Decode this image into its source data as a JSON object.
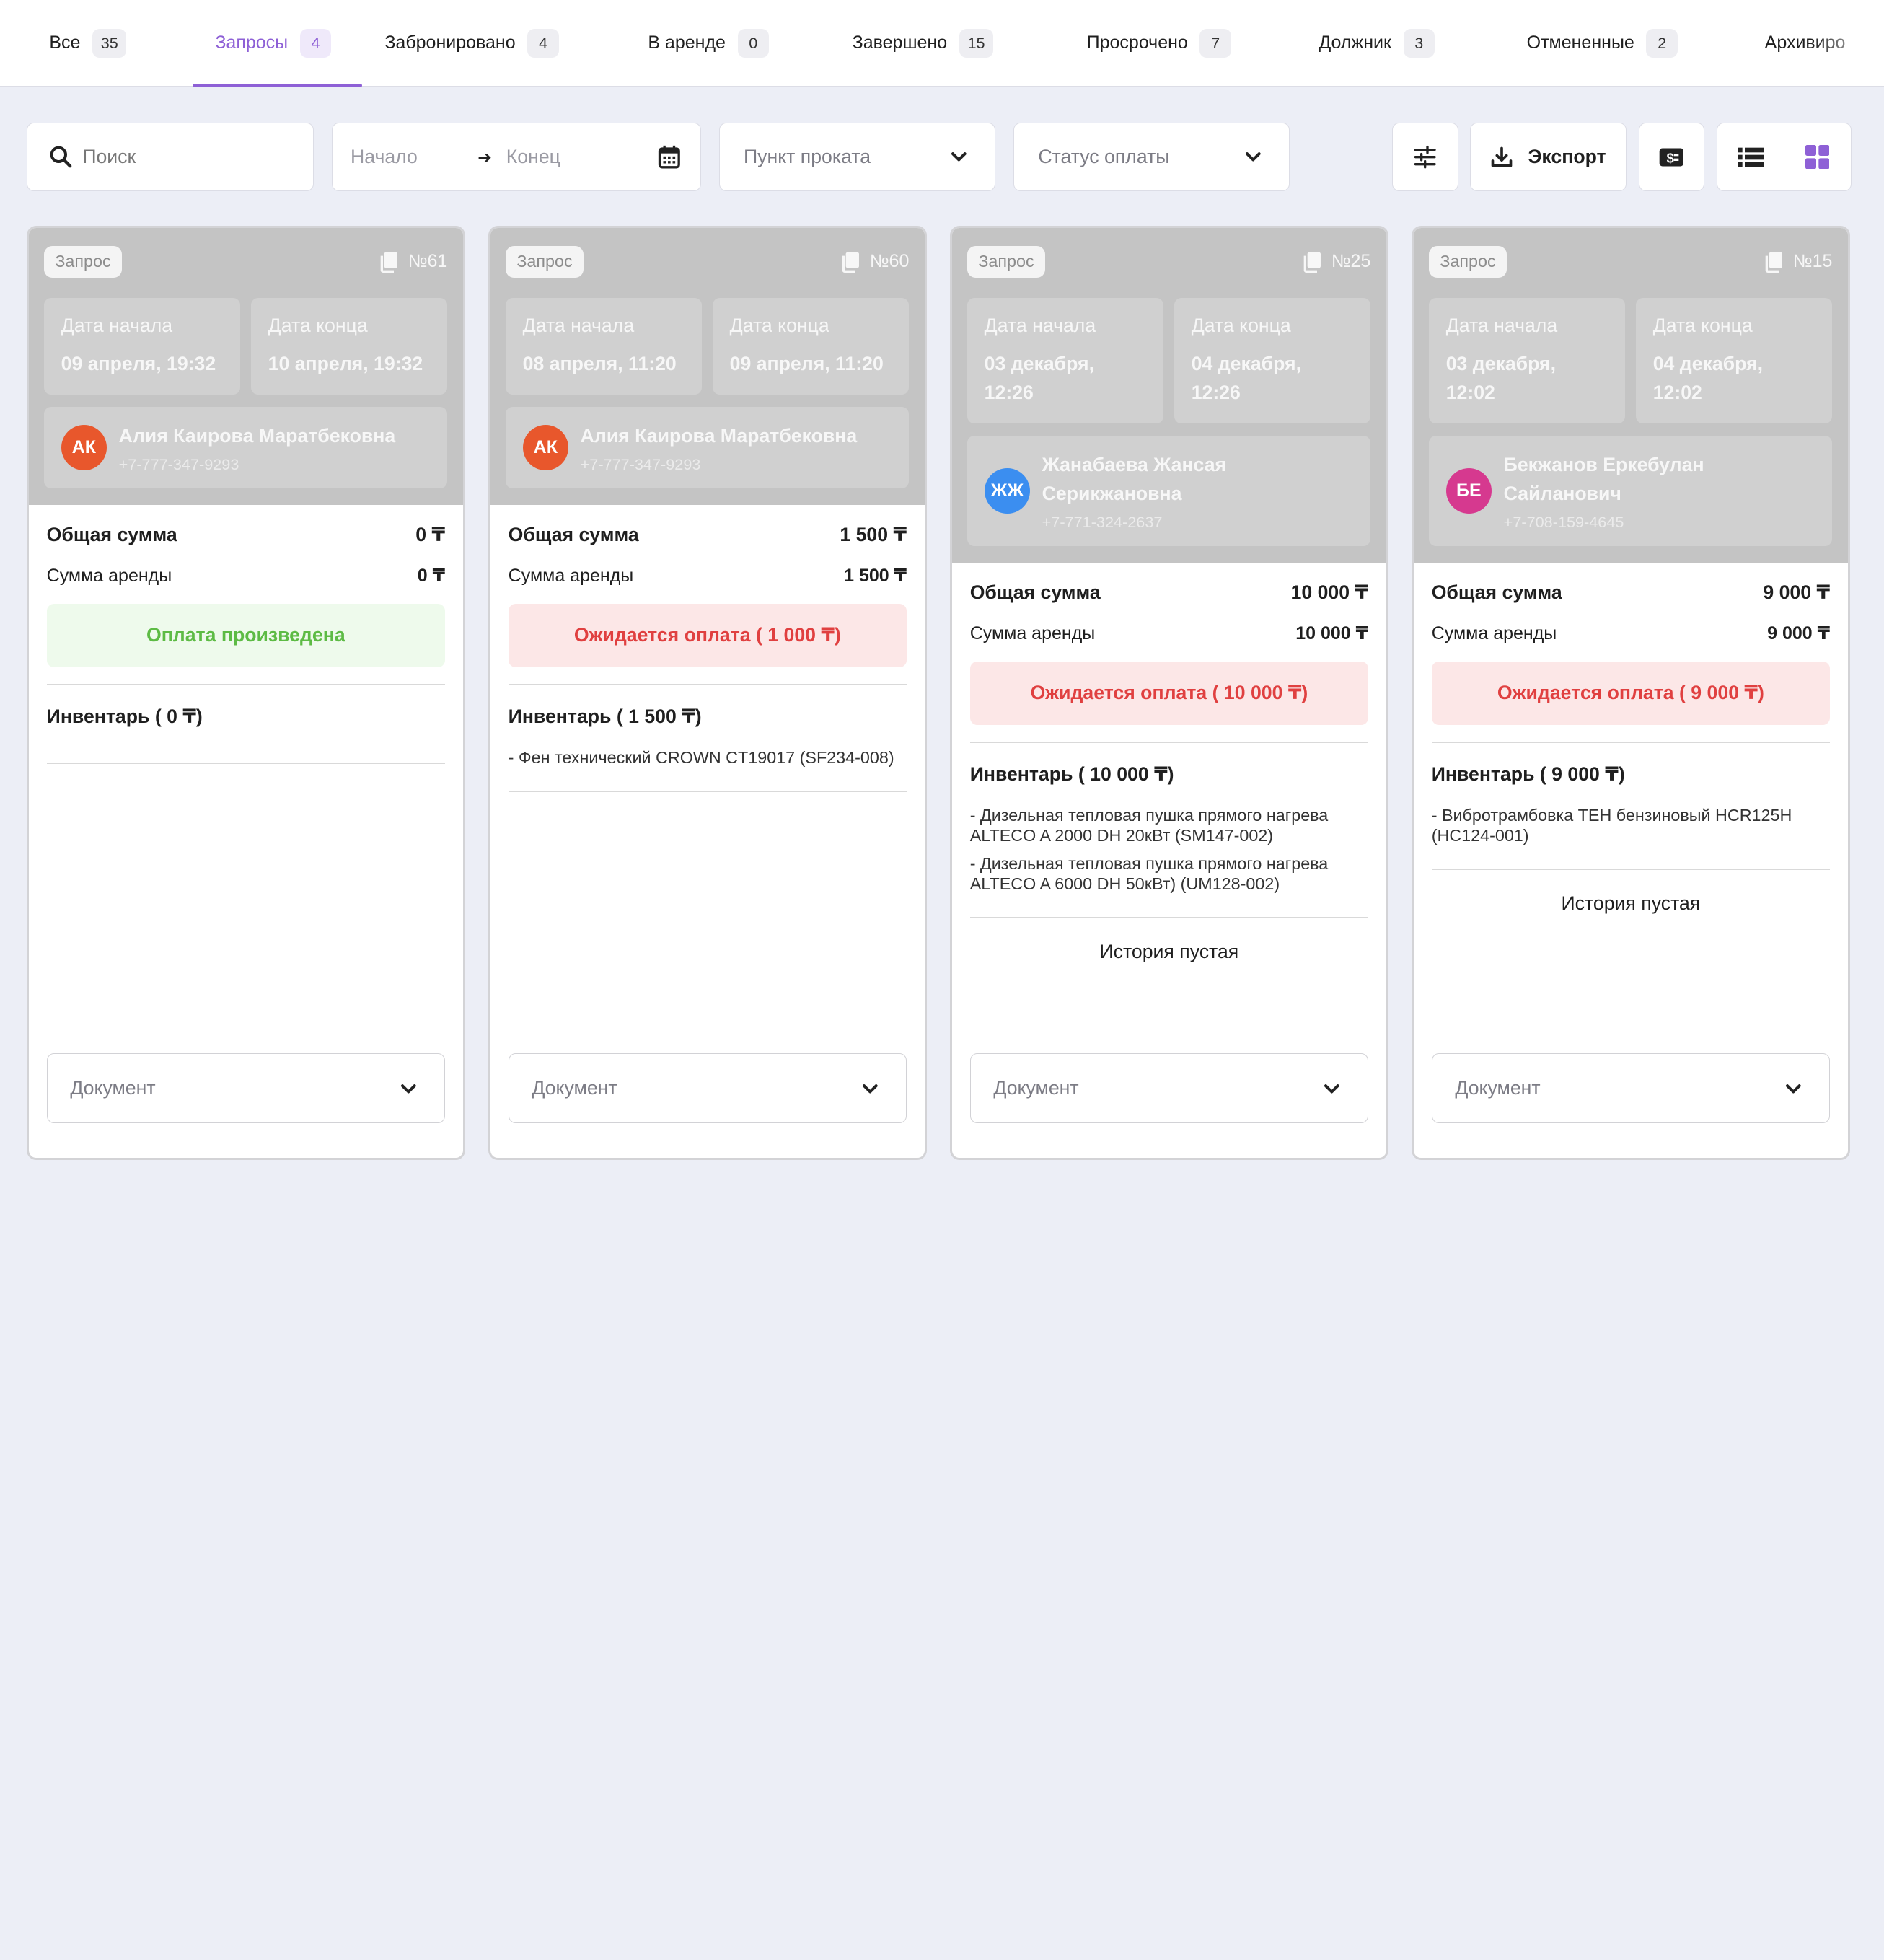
{
  "tabs": [
    {
      "label": "Все",
      "count": "35"
    },
    {
      "label": "Запросы",
      "count": "4"
    },
    {
      "label": "Забронировано",
      "count": "4"
    },
    {
      "label": "В аренде",
      "count": "0"
    },
    {
      "label": "Завершено",
      "count": "15"
    },
    {
      "label": "Просрочено",
      "count": "7"
    },
    {
      "label": "Должник",
      "count": "3"
    },
    {
      "label": "Отмененные",
      "count": "2"
    },
    {
      "label": "Архивиро",
      "count": ""
    }
  ],
  "active_tab": "Запросы",
  "colors": {
    "accent": "#8e60d6",
    "paid": "#5dbb45",
    "awaiting": "#e04040"
  },
  "toolbar": {
    "search_placeholder": "Поиск",
    "date_start_placeholder": "Начало",
    "date_end_placeholder": "Конец",
    "rental_point_placeholder": "Пункт проката",
    "payment_status_placeholder": "Статус оплаты",
    "export_label": "Экспорт"
  },
  "labels": {
    "start_date": "Дата начала",
    "end_date": "Дата конца",
    "total": "Общая сумма",
    "rent_sum": "Сумма аренды",
    "document": "Документ",
    "history_empty": "История пустая"
  },
  "cards": [
    {
      "status": "Запрос",
      "number": "№61",
      "start": "09 апреля, 19:32",
      "end": "10 апреля, 19:32",
      "client_initials": "АК",
      "avatar_color": "#e8572c",
      "client_name": "Алия Каирова Маратбековна",
      "client_phone": "+7-777-347-9293",
      "total": "0 ₸",
      "rent": "0 ₸",
      "payment": "Оплата произведена",
      "payment_state": "paid",
      "inventory_title": "Инвентарь ( 0 ₸)",
      "inventory": [],
      "history": ""
    },
    {
      "status": "Запрос",
      "number": "№60",
      "start": "08 апреля, 11:20",
      "end": "09 апреля, 11:20",
      "client_initials": "АК",
      "avatar_color": "#e8572c",
      "client_name": "Алия Каирова Маратбековна",
      "client_phone": "+7-777-347-9293",
      "total": "1 500 ₸",
      "rent": "1 500 ₸",
      "payment": "Ожидается оплата ( 1 000 ₸)",
      "payment_state": "awaiting",
      "inventory_title": "Инвентарь ( 1 500 ₸)",
      "inventory": [
        "- Фен технический CROWN CT19017 (SF234-008)"
      ],
      "history": ""
    },
    {
      "status": "Запрос",
      "number": "№25",
      "start": "03 декабря, 12:26",
      "end": "04 декабря, 12:26",
      "client_initials": "ЖЖ",
      "avatar_color": "#3b8ef0",
      "client_name": "Жанабаева Жансая Серикжановна",
      "client_phone": "+7-771-324-2637",
      "total": "10 000 ₸",
      "rent": "10 000 ₸",
      "payment": "Ожидается оплата ( 10 000 ₸)",
      "payment_state": "awaiting",
      "inventory_title": "Инвентарь ( 10 000 ₸)",
      "inventory": [
        "- Дизельная тепловая пушка прямого нагрева ALTECO A 2000 DH 20кВт (SM147-002)",
        "- Дизельная тепловая пушка прямого нагрева ALTECO A 6000 DH 50кВт) (UM128-002)"
      ],
      "history": "История пустая"
    },
    {
      "status": "Запрос",
      "number": "№15",
      "start": "03 декабря, 12:02",
      "end": "04 декабря, 12:02",
      "client_initials": "БЕ",
      "avatar_color": "#d6398f",
      "client_name": "Бекжанов Еркебулан Сайланович",
      "client_phone": "+7-708-159-4645",
      "total": "9 000 ₸",
      "rent": "9 000 ₸",
      "payment": "Ожидается оплата ( 9 000 ₸)",
      "payment_state": "awaiting",
      "inventory_title": "Инвентарь ( 9 000 ₸)",
      "inventory": [
        "- Вибротрамбовка ТЕН бензиновый HCR125H (HC124-001)"
      ],
      "history": "История пустая"
    }
  ]
}
